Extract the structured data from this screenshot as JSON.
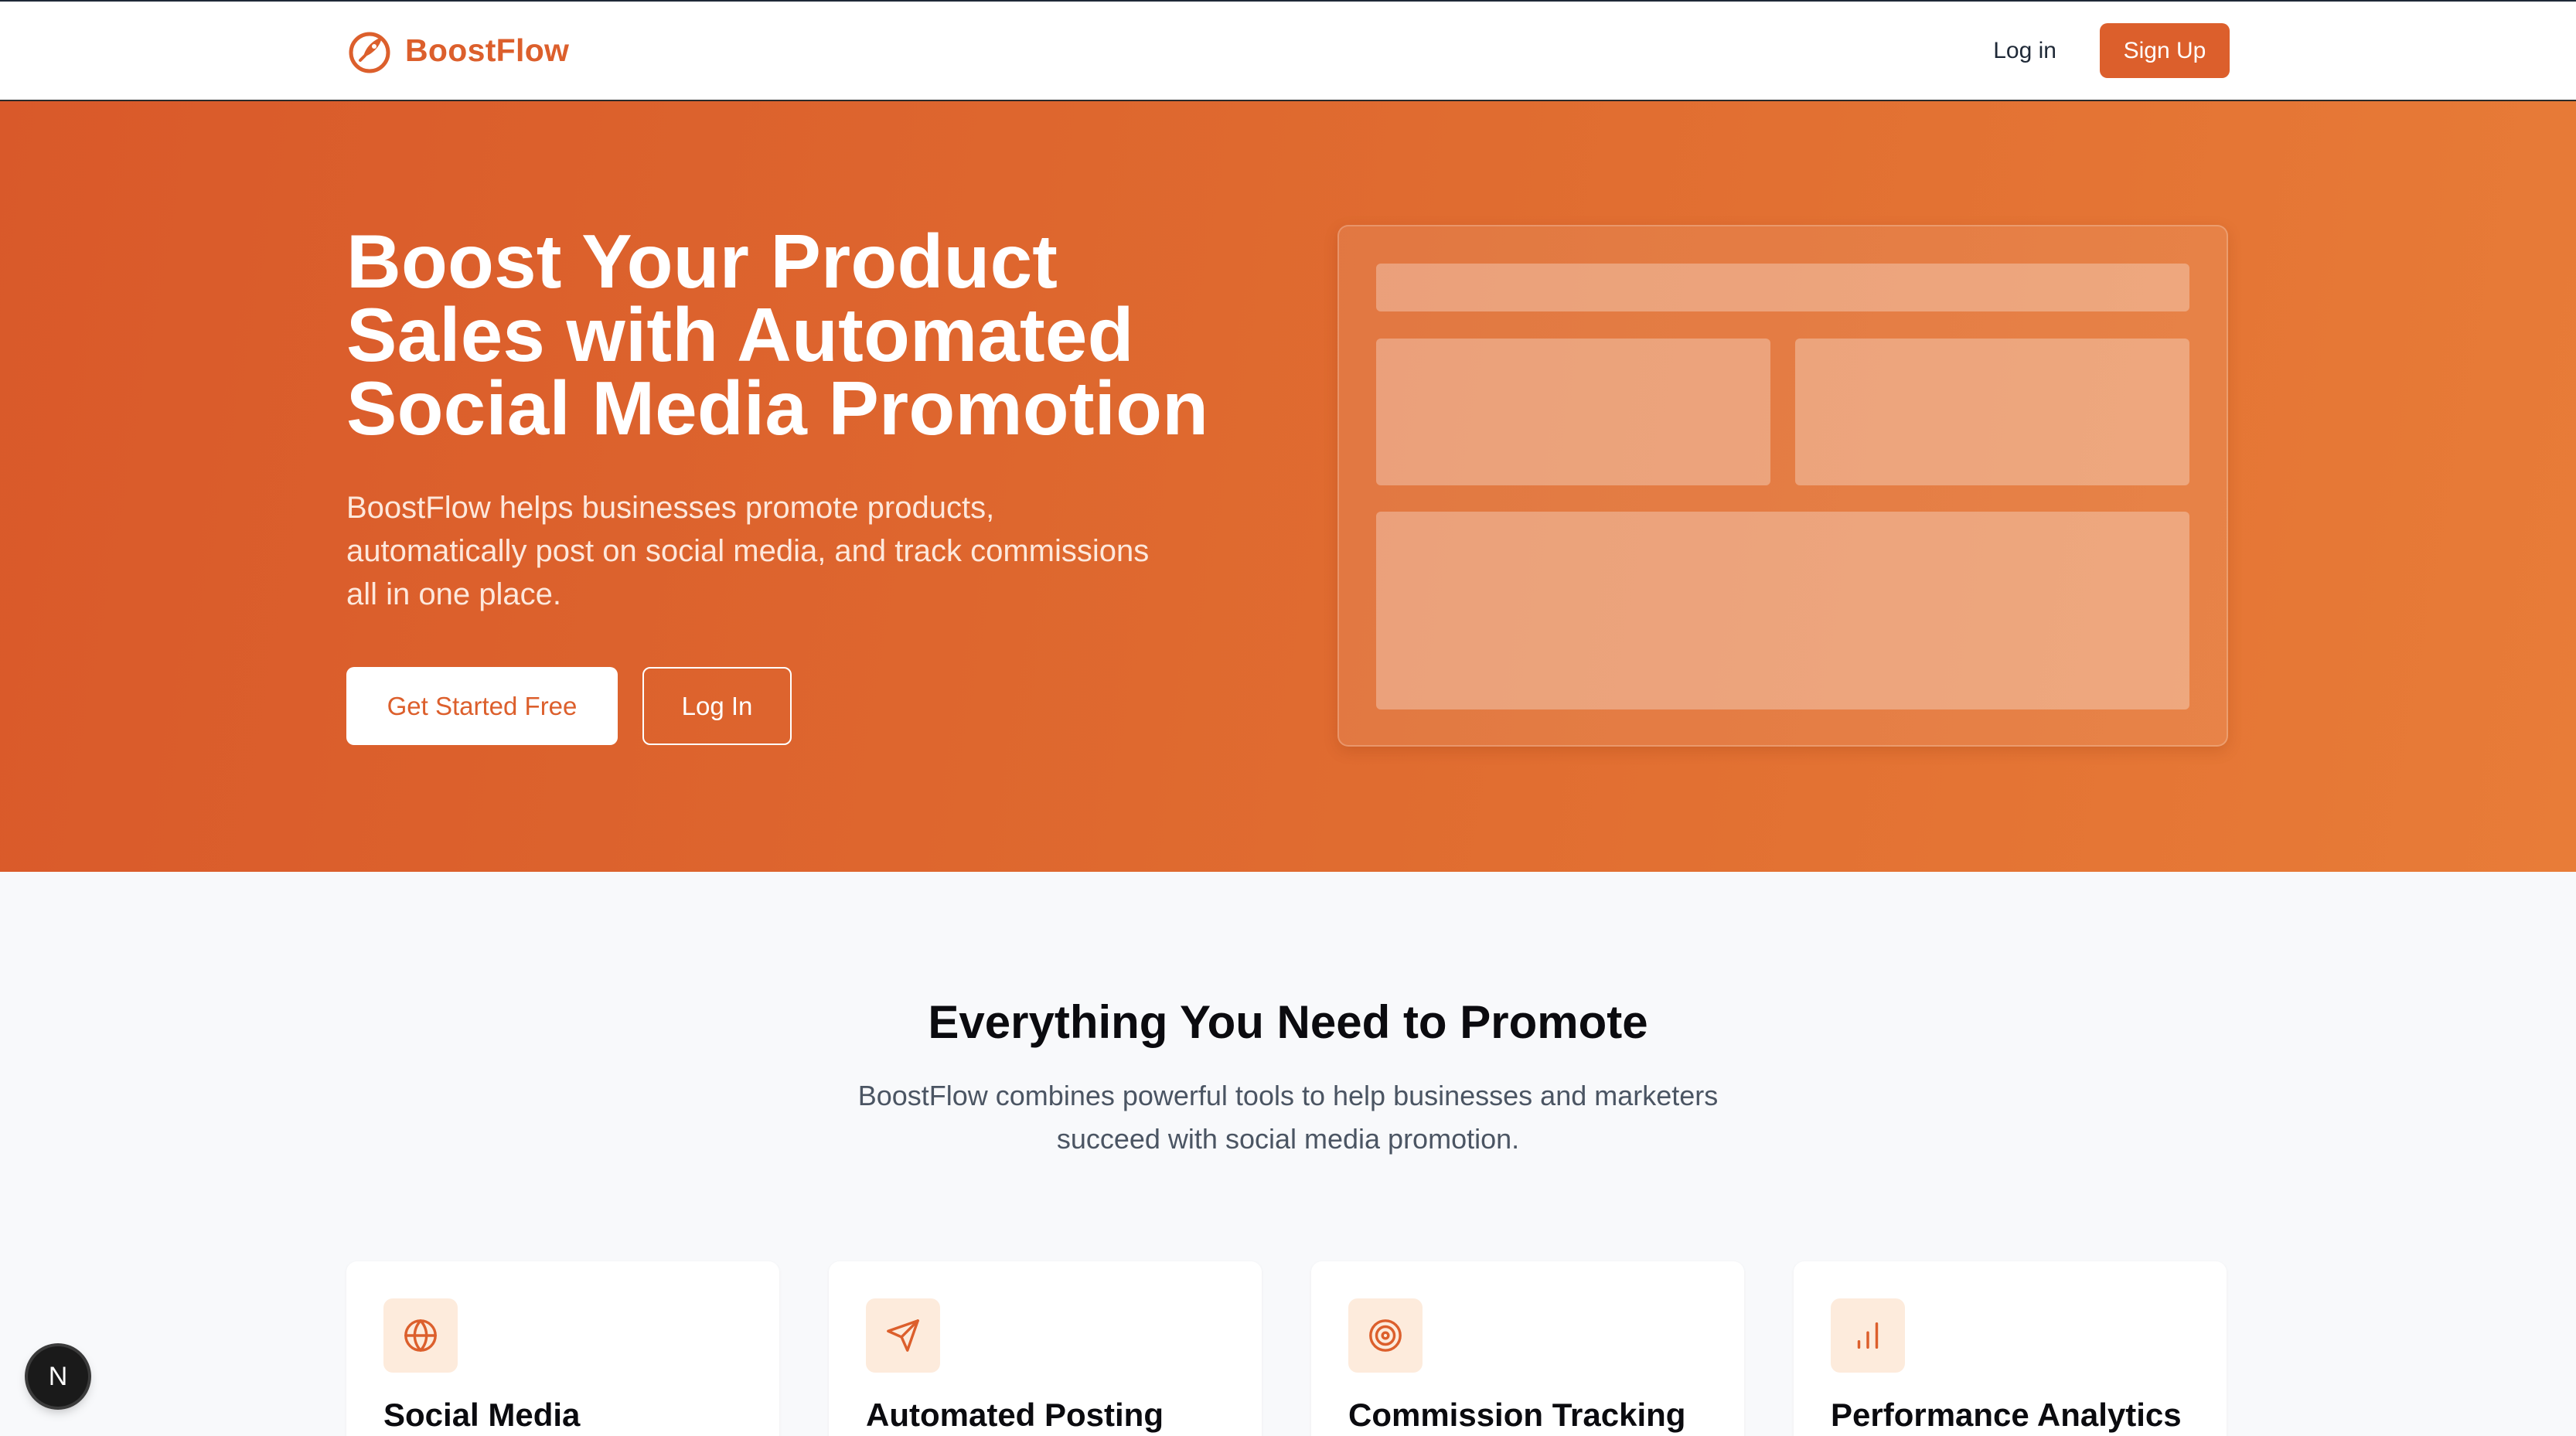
{
  "nav": {
    "brand": "BoostFlow",
    "login_label": "Log in",
    "signup_label": "Sign Up"
  },
  "hero": {
    "title_lines": [
      "Boost Your Product",
      "Sales with Automated",
      "Social Media Promotion"
    ],
    "subtitle_lines": [
      "BoostFlow helps businesses promote products,",
      "automatically post on social media, and track commissions",
      "all in one place."
    ],
    "primary_cta": "Get Started Free",
    "secondary_cta": "Log In"
  },
  "features": {
    "title": "Everything You Need to Promote",
    "subtitle_lines": [
      "BoostFlow combines powerful tools to help businesses and marketers",
      "succeed with social media promotion."
    ],
    "cards": [
      {
        "title": "Social Media",
        "icon": "globe-icon"
      },
      {
        "title": "Automated Posting",
        "icon": "send-icon"
      },
      {
        "title": "Commission Tracking",
        "icon": "target-icon"
      },
      {
        "title": "Performance Analytics",
        "icon": "bar-chart-icon"
      }
    ]
  },
  "dev_badge": {
    "label": "N",
    "icon": "nextjs-icon"
  },
  "colors": {
    "brand": "#dc5f2c",
    "hero_gradient_start": "#d9592a",
    "hero_gradient_end": "#e87c38",
    "icon_bg": "#fdebdc"
  }
}
